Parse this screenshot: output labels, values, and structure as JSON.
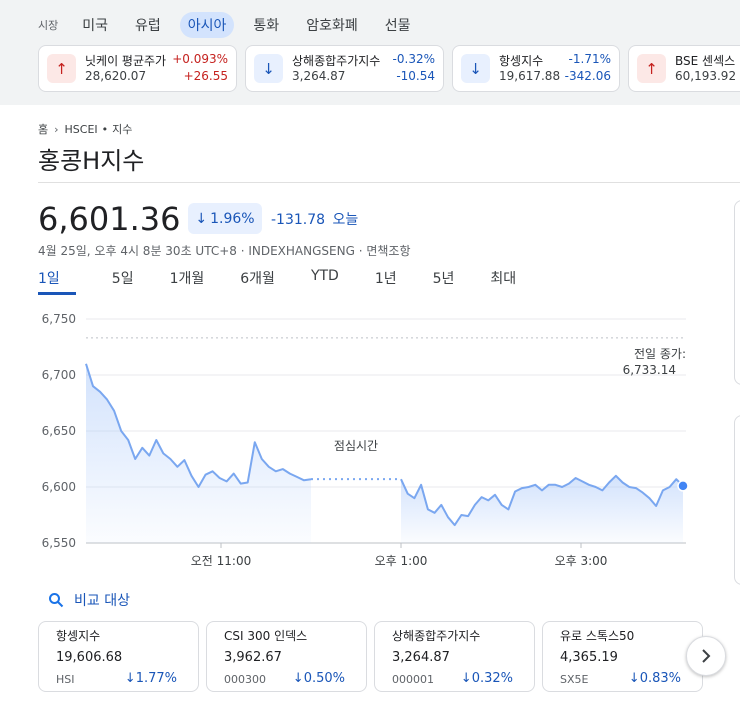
{
  "market_tabs": {
    "label": "시장",
    "items": [
      "미국",
      "유럽",
      "아시아",
      "통화",
      "암호화폐",
      "선물"
    ],
    "active_index": 2
  },
  "market_cards": [
    {
      "name": "닛케이 평균주가",
      "price": "28,620.07",
      "pct": "+0.093%",
      "change": "+26.55",
      "direction": "up"
    },
    {
      "name": "상해종합주가지수",
      "price": "3,264.87",
      "pct": "-0.32%",
      "change": "-10.54",
      "direction": "down"
    },
    {
      "name": "항셍지수",
      "price": "19,617.88",
      "pct": "-1.71%",
      "change": "-342.06",
      "direction": "down"
    },
    {
      "name": "BSE 센섹스",
      "price": "60,193.92",
      "pct": "",
      "change": "",
      "direction": "up"
    }
  ],
  "breadcrumb": {
    "home": "홈",
    "ticker": "HSCEI",
    "dot": "•",
    "type": "지수"
  },
  "title": "홍콩H지수",
  "quote": {
    "price": "6,601.36",
    "pct": "1.96%",
    "change": "-131.78",
    "period": "오늘",
    "meta": "4월 25일, 오후 4시 8분 30초 UTC+8 · INDEXHANGSENG · 면책조항"
  },
  "ranges": [
    "1일",
    "5일",
    "1개월",
    "6개월",
    "YTD",
    "1년",
    "5년",
    "최대"
  ],
  "active_range": "1일",
  "chart_data": {
    "type": "area",
    "y_ticks": [
      "6,750",
      "6,700",
      "6,650",
      "6,600",
      "6,550"
    ],
    "ylim": [
      6550,
      6750
    ],
    "x_ticks": [
      "오전 11:00",
      "오후 1:00",
      "오후 3:00"
    ],
    "previous_close": {
      "label": "전일 종가:",
      "value": "6,733.14",
      "y": 6733.14
    },
    "break_label": "점심시간",
    "morning_session": {
      "start": "09:30",
      "end": "12:00",
      "values": [
        6710,
        6690,
        6685,
        6678,
        6668,
        6650,
        6642,
        6625,
        6635,
        6628,
        6642,
        6630,
        6625,
        6618,
        6624,
        6610,
        6600,
        6611,
        6614,
        6608,
        6605,
        6612,
        6603,
        6604,
        6640,
        6625,
        6618,
        6614,
        6616,
        6612,
        6609,
        6606,
        6607
      ]
    },
    "afternoon_session": {
      "start": "13:00",
      "end": "16:08",
      "values": [
        6607,
        6594,
        6590,
        6602,
        6580,
        6577,
        6584,
        6573,
        6566,
        6575,
        6574,
        6584,
        6591,
        6588,
        6593,
        6584,
        6580,
        6596,
        6599,
        6600,
        6602,
        6597,
        6602,
        6602,
        6600,
        6603,
        6608,
        6605,
        6602,
        6600,
        6597,
        6604,
        6610,
        6604,
        6600,
        6599,
        6595,
        6590,
        6583,
        6597,
        6600,
        6607,
        6601
      ]
    },
    "grid": true,
    "color": "#7aa7f0"
  },
  "compare": {
    "label": "비교 대상"
  },
  "compare_cards": [
    {
      "name": "항셍지수",
      "price": "19,606.68",
      "ticker": "HSI",
      "pct": "1.77%"
    },
    {
      "name": "CSI 300 인덱스",
      "price": "3,962.67",
      "ticker": "000300",
      "pct": "0.50%"
    },
    {
      "name": "상해종합주가지수",
      "price": "3,264.87",
      "ticker": "000001",
      "pct": "0.32%"
    },
    {
      "name": "유로 스톡스50",
      "price": "4,365.19",
      "ticker": "SX5E",
      "pct": "0.83%"
    }
  ],
  "colors": {
    "down": "#1a56b8",
    "up": "#c5221f",
    "accent": "#1a73e8"
  }
}
